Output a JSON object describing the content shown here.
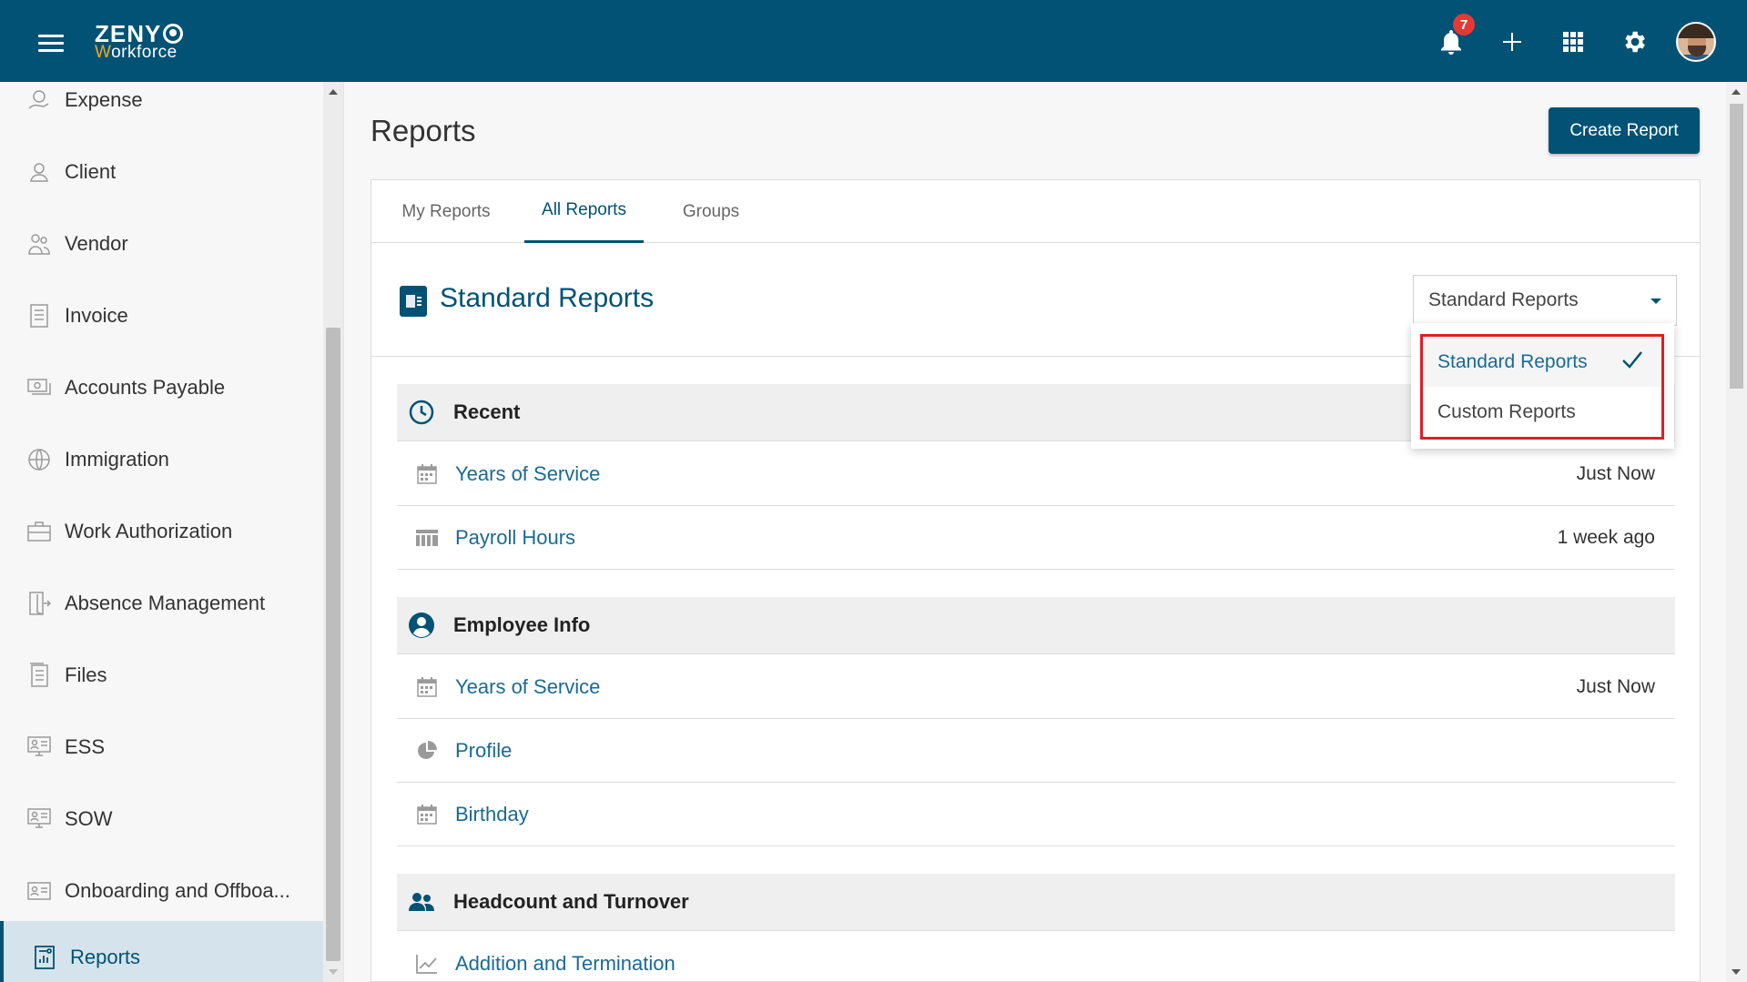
{
  "brand": {
    "line1": "ZENY",
    "line2_first": "W",
    "line2_rest": "orkforce"
  },
  "header": {
    "notification_count": "7"
  },
  "sidebar": {
    "items": [
      {
        "label": "Expense",
        "icon": "expense-icon"
      },
      {
        "label": "Client",
        "icon": "client-icon"
      },
      {
        "label": "Vendor",
        "icon": "vendor-icon"
      },
      {
        "label": "Invoice",
        "icon": "invoice-icon"
      },
      {
        "label": "Accounts Payable",
        "icon": "accounts-payable-icon"
      },
      {
        "label": "Immigration",
        "icon": "immigration-icon"
      },
      {
        "label": "Work Authorization",
        "icon": "work-authorization-icon"
      },
      {
        "label": "Absence Management",
        "icon": "absence-management-icon"
      },
      {
        "label": "Files",
        "icon": "files-icon"
      },
      {
        "label": "ESS",
        "icon": "ess-icon"
      },
      {
        "label": "SOW",
        "icon": "sow-icon"
      },
      {
        "label": "Onboarding and Offboa...",
        "icon": "onboarding-icon"
      },
      {
        "label": "Reports",
        "icon": "reports-icon",
        "active": true
      }
    ]
  },
  "main": {
    "title": "Reports",
    "create_button": "Create Report",
    "tabs": [
      {
        "label": "My Reports"
      },
      {
        "label": "All Reports",
        "active": true
      },
      {
        "label": "Groups"
      }
    ],
    "standard_reports": {
      "icon_text": "",
      "title": "Standard Reports",
      "select_value": "Standard Reports",
      "options": [
        {
          "label": "Standard Reports",
          "selected": true
        },
        {
          "label": "Custom Reports",
          "selected": false
        }
      ]
    },
    "sections": [
      {
        "title": "Recent",
        "icon": "clock-icon",
        "rows": [
          {
            "label": "Years of Service",
            "time": "Just Now",
            "icon": "calendar-icon"
          },
          {
            "label": "Payroll Hours",
            "time": "1 week ago",
            "icon": "table-icon"
          }
        ]
      },
      {
        "title": "Employee Info",
        "icon": "user-circle-icon",
        "rows": [
          {
            "label": "Years of Service",
            "time": "Just Now",
            "icon": "calendar-icon"
          },
          {
            "label": "Profile",
            "time": "",
            "icon": "pie-chart-icon"
          },
          {
            "label": "Birthday",
            "time": "",
            "icon": "calendar-icon"
          }
        ]
      },
      {
        "title": "Headcount and Turnover",
        "icon": "users-icon",
        "rows": [
          {
            "label": "Addition and Termination",
            "time": "",
            "icon": "line-chart-icon"
          }
        ]
      }
    ]
  },
  "colors": {
    "primary": "#015274",
    "link": "#1a6a94",
    "badge": "#e53935",
    "highlight_outline": "#e51c23"
  }
}
